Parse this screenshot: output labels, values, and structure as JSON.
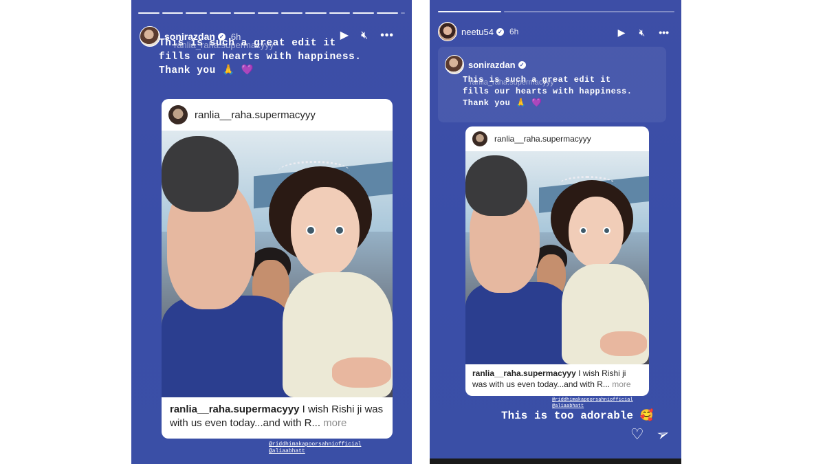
{
  "left": {
    "username": "sonirazdan",
    "verified_icon": "verified-badge-icon",
    "time": "6h",
    "controls": [
      "play-icon",
      "mute-icon",
      "more-icon"
    ],
    "overlay_lines": [
      "This is such a great edit it",
      "fills our hearts with happiness.",
      "Thank you 🙏 💜"
    ],
    "overlay_ghost": "ranlia_raha.supermacyyy",
    "card": {
      "user": "ranlia__raha.supermacyyy",
      "caption_user": "ranlia__raha.supermacyyy",
      "caption_text": " I wish Rishi ji was with us even today...and with R...",
      "more": " more"
    },
    "mentions": [
      "@riddhimakapoorsahniofficial",
      "@aliaabhatt"
    ]
  },
  "right": {
    "username": "neetu54",
    "time": "6h",
    "controls": [
      "play-icon",
      "mute-icon",
      "more-icon"
    ],
    "quoted_username": "sonirazdan",
    "overlay_lines": [
      "This is such a great edit it",
      "fills our hearts with happiness.",
      "Thank you 🙏 💜"
    ],
    "overlay_ghost": "ranlia_raha.supermacyyy",
    "card": {
      "user": "ranlia__raha.supermacyyy",
      "caption_user": "ranlia__raha.supermacyyy",
      "caption_text": " I wish Rishi ji was with us even today...and with R...",
      "more": " more"
    },
    "mentions": [
      "@riddhimakapoorsahniofficial",
      "@aliaabhatt"
    ],
    "reply_text": "This is too adorable 🥰",
    "actions": [
      "heart-icon",
      "send-icon"
    ]
  },
  "colors": {
    "story_bg": "#3a4ea8",
    "card_bg": "#ffffff"
  }
}
